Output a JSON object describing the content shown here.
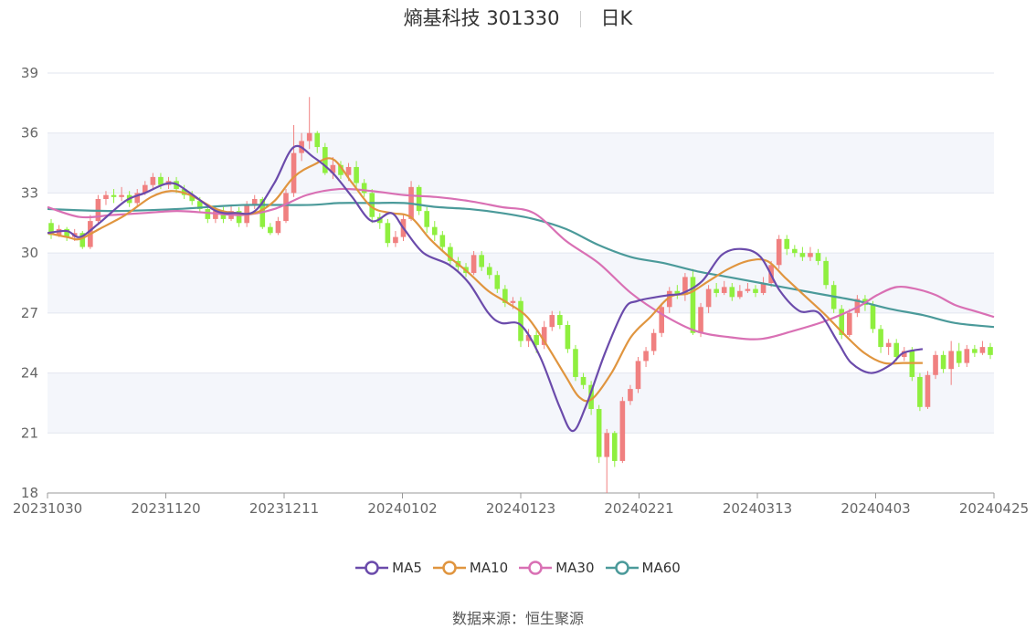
{
  "header": {
    "stock_title": "熵基科技 301330",
    "period": "日K"
  },
  "footer": {
    "source_label": "数据来源：",
    "source_name": "恒生聚源"
  },
  "colors": {
    "up": "#f08080",
    "down": "#8fef3f",
    "MA5": "#6b4bab",
    "MA10": "#e0953f",
    "MA30": "#d970b4",
    "MA60": "#4b9a9a",
    "band": "#f4f6fb",
    "grid": "#e2e6ef"
  },
  "chart_data": {
    "type": "candlestick",
    "title": "熵基科技 301330 日K",
    "y_ticks": [
      18,
      21,
      24,
      27,
      30,
      33,
      36,
      39
    ],
    "ylim": [
      18,
      39
    ],
    "x_ticks": [
      "20231030",
      "20231120",
      "20231211",
      "20240102",
      "20240123",
      "20240221",
      "20240313",
      "20240403",
      "20240425"
    ],
    "n_days": 121,
    "legend": [
      "MA5",
      "MA10",
      "MA30",
      "MA60"
    ],
    "candles": [
      [
        31.5,
        30.9,
        31.7,
        30.7
      ],
      [
        30.9,
        31.2,
        31.4,
        30.8
      ],
      [
        31.2,
        30.8,
        31.3,
        30.6
      ],
      [
        30.8,
        31.0,
        31.2,
        30.6
      ],
      [
        31.0,
        30.3,
        31.1,
        30.2
      ],
      [
        30.3,
        31.6,
        31.9,
        30.2
      ],
      [
        31.6,
        32.7,
        32.9,
        31.5
      ],
      [
        32.7,
        32.9,
        33.1,
        32.4
      ],
      [
        32.9,
        32.8,
        33.2,
        32.5
      ],
      [
        32.8,
        32.9,
        33.3,
        32.6
      ],
      [
        32.9,
        32.5,
        33.1,
        32.3
      ],
      [
        32.5,
        33.0,
        33.2,
        32.3
      ],
      [
        33.0,
        33.4,
        33.6,
        32.9
      ],
      [
        33.4,
        33.8,
        34.0,
        33.2
      ],
      [
        33.8,
        33.4,
        34.0,
        33.2
      ],
      [
        33.4,
        33.6,
        33.8,
        33.2
      ],
      [
        33.6,
        33.2,
        33.8,
        33.0
      ],
      [
        33.2,
        32.9,
        33.4,
        32.7
      ],
      [
        32.9,
        32.6,
        33.1,
        32.4
      ],
      [
        32.6,
        32.2,
        32.8,
        32.0
      ],
      [
        32.2,
        31.7,
        32.4,
        31.5
      ],
      [
        31.7,
        32.1,
        32.3,
        31.5
      ],
      [
        32.1,
        31.7,
        32.3,
        31.5
      ],
      [
        31.7,
        32.1,
        32.4,
        31.6
      ],
      [
        32.1,
        31.5,
        32.3,
        31.3
      ],
      [
        31.5,
        32.4,
        32.6,
        31.3
      ],
      [
        32.4,
        32.7,
        32.9,
        32.2
      ],
      [
        32.7,
        31.3,
        32.8,
        31.2
      ],
      [
        31.3,
        31.0,
        31.5,
        30.9
      ],
      [
        31.0,
        31.6,
        31.8,
        30.9
      ],
      [
        31.6,
        33.0,
        33.2,
        31.5
      ],
      [
        33.0,
        35.0,
        36.4,
        32.8
      ],
      [
        35.0,
        35.6,
        36.0,
        34.6
      ],
      [
        35.6,
        36.0,
        37.8,
        35.2
      ],
      [
        36.0,
        35.3,
        36.1,
        35.0
      ],
      [
        35.3,
        34.0,
        35.5,
        33.9
      ],
      [
        34.0,
        34.4,
        34.8,
        33.7
      ],
      [
        34.4,
        33.9,
        34.6,
        33.7
      ],
      [
        33.9,
        34.3,
        34.5,
        33.6
      ],
      [
        34.3,
        33.5,
        34.6,
        33.3
      ],
      [
        33.5,
        33.0,
        33.7,
        32.8
      ],
      [
        33.0,
        31.8,
        33.2,
        31.5
      ],
      [
        31.8,
        31.5,
        32.0,
        31.2
      ],
      [
        31.5,
        30.5,
        31.7,
        30.3
      ],
      [
        30.5,
        30.8,
        31.1,
        30.3
      ],
      [
        30.8,
        31.7,
        31.9,
        30.6
      ],
      [
        31.7,
        33.3,
        33.6,
        31.6
      ],
      [
        33.3,
        32.1,
        33.4,
        31.9
      ],
      [
        32.1,
        31.3,
        32.3,
        31.0
      ],
      [
        31.3,
        30.9,
        31.6,
        30.6
      ],
      [
        30.9,
        30.3,
        31.1,
        30.1
      ],
      [
        30.3,
        29.6,
        30.5,
        29.4
      ],
      [
        29.6,
        29.3,
        29.8,
        29.1
      ],
      [
        29.3,
        29.0,
        29.5,
        28.8
      ],
      [
        29.0,
        29.9,
        30.1,
        28.9
      ],
      [
        29.9,
        29.3,
        30.1,
        29.1
      ],
      [
        29.3,
        28.9,
        29.5,
        28.7
      ],
      [
        28.9,
        28.2,
        29.1,
        28.0
      ],
      [
        28.2,
        27.5,
        28.4,
        27.3
      ],
      [
        27.5,
        27.6,
        27.8,
        27.2
      ],
      [
        27.6,
        25.6,
        27.8,
        25.3
      ],
      [
        25.6,
        25.9,
        26.2,
        25.3
      ],
      [
        25.9,
        25.4,
        26.1,
        25.0
      ],
      [
        25.4,
        26.3,
        26.6,
        25.2
      ],
      [
        26.3,
        26.9,
        27.1,
        26.1
      ],
      [
        26.9,
        26.4,
        27.1,
        26.2
      ],
      [
        26.4,
        25.2,
        26.6,
        25.0
      ],
      [
        25.2,
        23.8,
        25.4,
        23.6
      ],
      [
        23.8,
        23.4,
        24.0,
        23.2
      ],
      [
        23.4,
        22.2,
        23.6,
        21.9
      ],
      [
        22.2,
        19.8,
        22.4,
        19.5
      ],
      [
        19.8,
        21.0,
        21.2,
        18.0
      ],
      [
        21.0,
        19.6,
        21.1,
        19.3
      ],
      [
        19.6,
        22.6,
        22.8,
        19.5
      ],
      [
        22.6,
        23.2,
        23.4,
        22.4
      ],
      [
        23.2,
        24.6,
        24.8,
        23.0
      ],
      [
        24.6,
        25.1,
        25.3,
        24.3
      ],
      [
        25.1,
        26.0,
        26.2,
        24.9
      ],
      [
        26.0,
        27.3,
        27.5,
        25.8
      ],
      [
        27.3,
        28.1,
        28.3,
        27.0
      ],
      [
        28.1,
        27.9,
        28.4,
        27.7
      ],
      [
        27.9,
        28.8,
        29.0,
        27.6
      ],
      [
        28.8,
        26.0,
        29.2,
        25.9
      ],
      [
        26.0,
        27.3,
        27.5,
        25.8
      ],
      [
        27.3,
        28.2,
        28.4,
        27.0
      ],
      [
        28.2,
        28.0,
        28.5,
        27.8
      ],
      [
        28.0,
        28.3,
        28.6,
        27.9
      ],
      [
        28.3,
        27.8,
        28.5,
        27.6
      ],
      [
        27.8,
        28.1,
        28.4,
        27.7
      ],
      [
        28.1,
        28.2,
        28.5,
        28.0
      ],
      [
        28.2,
        28.0,
        28.4,
        27.8
      ],
      [
        28.0,
        28.5,
        28.8,
        27.9
      ],
      [
        28.5,
        29.4,
        29.6,
        28.3
      ],
      [
        29.4,
        30.7,
        30.9,
        29.2
      ],
      [
        30.7,
        30.2,
        30.9,
        29.9
      ],
      [
        30.2,
        30.0,
        30.4,
        29.8
      ],
      [
        30.0,
        29.8,
        30.3,
        29.6
      ],
      [
        29.8,
        30.0,
        30.3,
        29.6
      ],
      [
        30.0,
        29.6,
        30.2,
        29.4
      ],
      [
        29.6,
        28.4,
        29.8,
        28.2
      ],
      [
        28.4,
        27.2,
        28.6,
        27.0
      ],
      [
        27.2,
        25.9,
        27.4,
        25.7
      ],
      [
        25.9,
        27.0,
        27.2,
        25.8
      ],
      [
        27.0,
        27.7,
        27.9,
        26.8
      ],
      [
        27.7,
        27.4,
        27.9,
        27.1
      ],
      [
        27.4,
        26.2,
        27.6,
        26.0
      ],
      [
        26.2,
        25.3,
        26.4,
        25.0
      ],
      [
        25.3,
        25.5,
        25.7,
        24.9
      ],
      [
        25.5,
        24.8,
        25.7,
        24.6
      ],
      [
        24.8,
        25.1,
        25.3,
        24.6
      ],
      [
        25.1,
        23.8,
        25.3,
        23.6
      ],
      [
        23.8,
        22.3,
        24.0,
        22.1
      ],
      [
        22.3,
        23.9,
        24.1,
        22.2
      ],
      [
        23.9,
        24.9,
        25.1,
        23.7
      ],
      [
        24.9,
        24.2,
        25.1,
        24.0
      ],
      [
        24.2,
        25.1,
        25.6,
        23.4
      ],
      [
        25.1,
        24.5,
        25.5,
        24.3
      ],
      [
        24.5,
        25.2,
        25.4,
        24.3
      ],
      [
        25.2,
        25.0,
        25.4,
        24.8
      ],
      [
        25.0,
        25.3,
        25.6,
        24.9
      ],
      [
        25.3,
        24.9,
        25.5,
        24.7
      ]
    ],
    "ma": {
      "MA5": [
        [
          0,
          31.0
        ],
        [
          3,
          31.1
        ],
        [
          5,
          30.8
        ],
        [
          8,
          31.5
        ],
        [
          12,
          32.6
        ],
        [
          15,
          33.0
        ],
        [
          19,
          33.5
        ],
        [
          22,
          33.0
        ],
        [
          26,
          32.1
        ],
        [
          29,
          32.0
        ],
        [
          32,
          32.1
        ],
        [
          35,
          33.5
        ],
        [
          38,
          35.3
        ],
        [
          41,
          34.8
        ],
        [
          44,
          34.0
        ],
        [
          47,
          32.8
        ],
        [
          50,
          31.6
        ],
        [
          53,
          32.0
        ],
        [
          55,
          31.2
        ],
        [
          58,
          30.0
        ],
        [
          62,
          29.4
        ],
        [
          65,
          28.5
        ],
        [
          68,
          27.0
        ],
        [
          70,
          26.5
        ],
        [
          73,
          26.4
        ],
        [
          76,
          24.8
        ],
        [
          79,
          22.3
        ],
        [
          81,
          21.1
        ],
        [
          83,
          22.3
        ],
        [
          86,
          25.0
        ],
        [
          89,
          27.2
        ],
        [
          91,
          27.6
        ],
        [
          94,
          27.8
        ],
        [
          96,
          27.9
        ],
        [
          98,
          28.0
        ],
        [
          101,
          28.6
        ],
        [
          104,
          29.9
        ],
        [
          107,
          30.2
        ],
        [
          110,
          29.8
        ],
        [
          113,
          28.1
        ],
        [
          116,
          27.1
        ],
        [
          119,
          27.0
        ],
        [
          122,
          25.5
        ],
        [
          124,
          24.5
        ],
        [
          127,
          24.0
        ],
        [
          130,
          24.4
        ],
        [
          132,
          25.0
        ],
        [
          135,
          25.2
        ]
      ],
      "MA10": [
        [
          0,
          31.0
        ],
        [
          3,
          30.8
        ],
        [
          5,
          30.7
        ],
        [
          8,
          31.2
        ],
        [
          12,
          31.9
        ],
        [
          16,
          32.8
        ],
        [
          19,
          33.1
        ],
        [
          22,
          32.9
        ],
        [
          26,
          32.2
        ],
        [
          29,
          32.0
        ],
        [
          32,
          32.0
        ],
        [
          35,
          32.6
        ],
        [
          38,
          33.8
        ],
        [
          41,
          34.4
        ],
        [
          44,
          34.7
        ],
        [
          47,
          33.5
        ],
        [
          50,
          32.3
        ],
        [
          53,
          32.0
        ],
        [
          56,
          31.8
        ],
        [
          59,
          30.7
        ],
        [
          62,
          29.8
        ],
        [
          65,
          29.0
        ],
        [
          68,
          28.1
        ],
        [
          71,
          27.5
        ],
        [
          74,
          26.8
        ],
        [
          77,
          25.4
        ],
        [
          80,
          23.8
        ],
        [
          82,
          22.8
        ],
        [
          84,
          22.7
        ],
        [
          87,
          24.0
        ],
        [
          90,
          25.8
        ],
        [
          93,
          26.8
        ],
        [
          96,
          27.8
        ],
        [
          99,
          28.0
        ],
        [
          102,
          28.6
        ],
        [
          105,
          29.2
        ],
        [
          108,
          29.6
        ],
        [
          111,
          29.6
        ],
        [
          114,
          28.7
        ],
        [
          117,
          27.8
        ],
        [
          120,
          26.9
        ],
        [
          123,
          25.9
        ],
        [
          126,
          25.0
        ],
        [
          129,
          24.5
        ],
        [
          132,
          24.5
        ],
        [
          135,
          24.5
        ]
      ],
      "MA30": [
        [
          0,
          32.3
        ],
        [
          5,
          31.8
        ],
        [
          10,
          31.9
        ],
        [
          15,
          32.0
        ],
        [
          20,
          32.1
        ],
        [
          25,
          32.0
        ],
        [
          30,
          31.9
        ],
        [
          35,
          32.2
        ],
        [
          40,
          32.9
        ],
        [
          45,
          33.2
        ],
        [
          50,
          33.1
        ],
        [
          55,
          32.9
        ],
        [
          60,
          32.8
        ],
        [
          65,
          32.6
        ],
        [
          70,
          32.3
        ],
        [
          75,
          32.0
        ],
        [
          80,
          30.6
        ],
        [
          85,
          29.5
        ],
        [
          90,
          28.0
        ],
        [
          95,
          26.9
        ],
        [
          100,
          26.1
        ],
        [
          105,
          25.8
        ],
        [
          110,
          25.7
        ],
        [
          115,
          26.1
        ],
        [
          120,
          26.6
        ],
        [
          125,
          27.3
        ],
        [
          128,
          27.9
        ],
        [
          131,
          28.3
        ],
        [
          134,
          28.2
        ],
        [
          137,
          27.9
        ],
        [
          140,
          27.4
        ],
        [
          143,
          27.1
        ],
        [
          146,
          26.8
        ]
      ],
      "MA60": [
        [
          0,
          32.2
        ],
        [
          10,
          32.1
        ],
        [
          20,
          32.2
        ],
        [
          30,
          32.4
        ],
        [
          40,
          32.4
        ],
        [
          45,
          32.5
        ],
        [
          50,
          32.5
        ],
        [
          55,
          32.5
        ],
        [
          60,
          32.3
        ],
        [
          65,
          32.2
        ],
        [
          70,
          32.0
        ],
        [
          75,
          31.7
        ],
        [
          80,
          31.2
        ],
        [
          85,
          30.4
        ],
        [
          90,
          29.8
        ],
        [
          95,
          29.5
        ],
        [
          100,
          29.1
        ],
        [
          105,
          28.8
        ],
        [
          110,
          28.5
        ],
        [
          115,
          28.2
        ],
        [
          120,
          27.9
        ],
        [
          125,
          27.6
        ],
        [
          130,
          27.2
        ],
        [
          135,
          26.9
        ],
        [
          140,
          26.5
        ],
        [
          146,
          26.3
        ]
      ]
    }
  }
}
